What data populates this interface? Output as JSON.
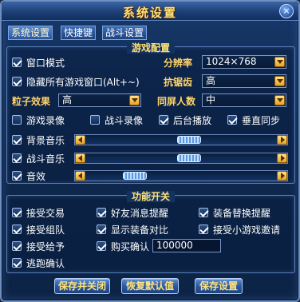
{
  "window": {
    "title": "系统设置",
    "close_glyph": "×"
  },
  "tabs": [
    "系统设置",
    "快捷键",
    "战斗设置"
  ],
  "game_config": {
    "title": "游戏配置",
    "window_mode": {
      "label": "窗口模式",
      "checked": true
    },
    "resolution": {
      "label": "分辨率",
      "value": "1024×768"
    },
    "hide_windows": {
      "label": "隐藏所有游戏窗口(Alt+~)",
      "checked": true
    },
    "antialias": {
      "label": "抗锯齿",
      "value": "高"
    },
    "particle": {
      "label": "粒子效果",
      "value": "高"
    },
    "same_screen": {
      "label": "同屏人数",
      "value": "中"
    },
    "game_record": {
      "label": "游戏录像",
      "checked": false
    },
    "battle_record": {
      "label": "战斗录像",
      "checked": false
    },
    "bg_play": {
      "label": "后台播放",
      "checked": true
    },
    "vsync": {
      "label": "垂直同步",
      "checked": true
    },
    "bg_music": {
      "label": "背景音乐",
      "checked": true,
      "level": 0.55
    },
    "battle_music": {
      "label": "战斗音乐",
      "checked": true,
      "level": 0.55
    },
    "sound_fx": {
      "label": "音效",
      "checked": true,
      "level": 0.22
    }
  },
  "features": {
    "title": "功能开关",
    "accept_trade": {
      "label": "接受交易",
      "checked": true
    },
    "friend_msg": {
      "label": "好友消息提醒",
      "checked": true
    },
    "equip_replace": {
      "label": "装备替换提醒",
      "checked": true
    },
    "accept_team": {
      "label": "接受组队",
      "checked": true
    },
    "show_compare": {
      "label": "显示装备对比",
      "checked": true
    },
    "accept_minigame": {
      "label": "接受小游戏邀请",
      "checked": true
    },
    "accept_give": {
      "label": "接受给予",
      "checked": true
    },
    "buy_confirm": {
      "label": "购买确认",
      "checked": true,
      "value": "100000"
    },
    "flee_confirm": {
      "label": "逃跑确认",
      "checked": true
    }
  },
  "buttons": {
    "save_close": "保存并关闭",
    "restore_default": "恢复默认值",
    "save": "保存设置"
  },
  "colors": {
    "accent_gold": "#ffe27a",
    "panel_border": "#5a7fb8",
    "window_bg": "#0f2a52"
  }
}
